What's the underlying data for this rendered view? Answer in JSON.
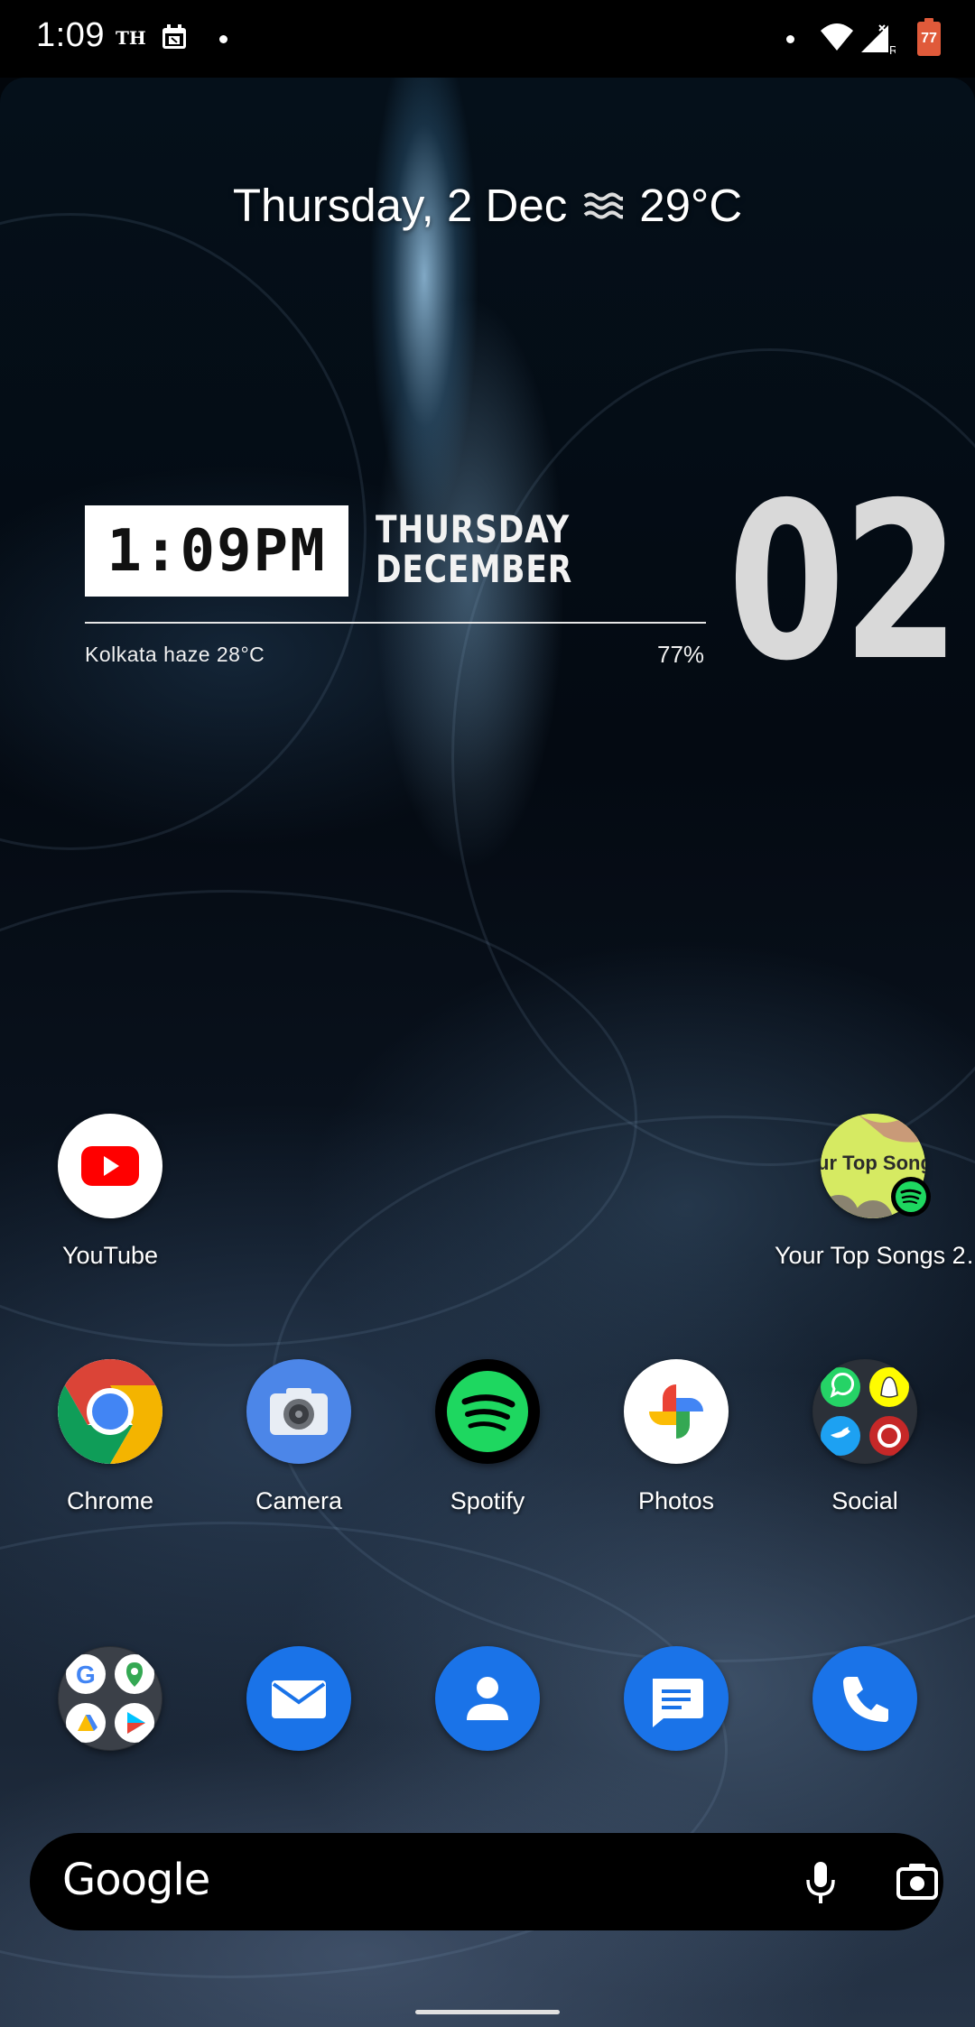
{
  "status_bar": {
    "time": "1:09",
    "carrier_icon_label": "TH",
    "battery_level": "77",
    "icons": [
      "calendar-icon",
      "notification-dot-icon",
      "wifi-icon",
      "signal-icon",
      "battery-icon"
    ]
  },
  "at_a_glance": {
    "date": "Thursday, 2 Dec",
    "weather_icon": "haze-icon",
    "temperature": "29°C"
  },
  "clock_widget": {
    "time": "1:09PM",
    "weekday": "THURSDAY",
    "month": "DECEMBER",
    "weather": "Kolkata haze 28°C",
    "percentage": "77%",
    "day_number": "02"
  },
  "apps_row1": [
    {
      "label": "YouTube",
      "icon": "youtube-icon"
    },
    {
      "label": "Your Top Songs 2…",
      "icon": "spotify-playlist-shortcut-icon"
    }
  ],
  "apps_row2": [
    {
      "label": "Chrome",
      "icon": "chrome-icon"
    },
    {
      "label": "Camera",
      "icon": "camera-icon"
    },
    {
      "label": "Spotify",
      "icon": "spotify-icon"
    },
    {
      "label": "Photos",
      "icon": "photos-icon"
    },
    {
      "label": "Social",
      "icon": "social-folder-icon"
    }
  ],
  "dock": [
    {
      "icon": "google-folder-icon"
    },
    {
      "icon": "email-icon"
    },
    {
      "icon": "contacts-icon"
    },
    {
      "icon": "messages-icon"
    },
    {
      "icon": "phone-icon"
    }
  ],
  "search_bar": {
    "logo": "Google",
    "icons": [
      "mic-icon",
      "lens-icon"
    ]
  },
  "playlist_art_text": "ur Top Songs",
  "colors": {
    "youtube_red": "#ff0000",
    "spotify_green": "#1ed760",
    "dock_blue": "#1a73e8",
    "battery_orange": "#e05a3a"
  }
}
